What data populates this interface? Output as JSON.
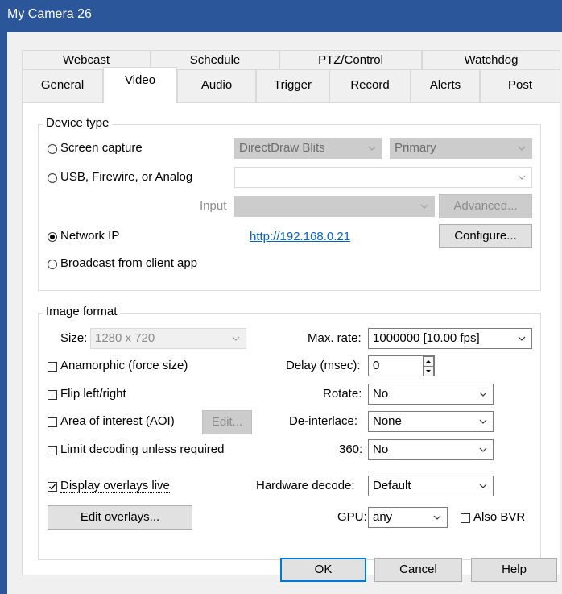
{
  "window": {
    "title": "My Camera 26"
  },
  "tabs_row1": [
    "Webcast",
    "Schedule",
    "PTZ/Control",
    "Watchdog"
  ],
  "tabs_row2": [
    "General",
    "Video",
    "Audio",
    "Trigger",
    "Record",
    "Alerts",
    "Post"
  ],
  "active_tab": "Video",
  "device_type": {
    "legend": "Device type",
    "screen_capture": "Screen capture",
    "screen_method": "DirectDraw Blits",
    "screen_monitor": "Primary",
    "usb": "USB, Firewire, or Analog",
    "usb_device": "",
    "input_label": "Input",
    "input_value": "",
    "advanced": "Advanced...",
    "network_ip": "Network IP",
    "network_url": "http://192.168.0.21",
    "configure": "Configure...",
    "broadcast": "Broadcast from client app",
    "selected": "network_ip"
  },
  "image_format": {
    "legend": "Image format",
    "size_label": "Size:",
    "size_value": "1280 x 720",
    "anamorphic": "Anamorphic (force size)",
    "flip": "Flip left/right",
    "aoi": "Area of interest (AOI)",
    "aoi_edit": "Edit...",
    "limit_decoding": "Limit decoding unless required",
    "display_overlays": "Display overlays live",
    "edit_overlays": "Edit overlays...",
    "max_rate_label": "Max. rate:",
    "max_rate_value": "1000000 [10.00 fps]",
    "delay_label": "Delay (msec):",
    "delay_value": "0",
    "rotate_label": "Rotate:",
    "rotate_value": "No",
    "deinterlace_label": "De-interlace:",
    "deinterlace_value": "None",
    "three60_label": "360:",
    "three60_value": "No",
    "hw_decode_label": "Hardware decode:",
    "hw_decode_value": "Default",
    "gpu_label": "GPU:",
    "gpu_value": "any",
    "also_bvr": "Also BVR",
    "checked": {
      "anamorphic": false,
      "flip": false,
      "aoi": false,
      "limit_decoding": false,
      "display_overlays": true,
      "also_bvr": false
    }
  },
  "footer": {
    "ok": "OK",
    "cancel": "Cancel",
    "help": "Help"
  }
}
